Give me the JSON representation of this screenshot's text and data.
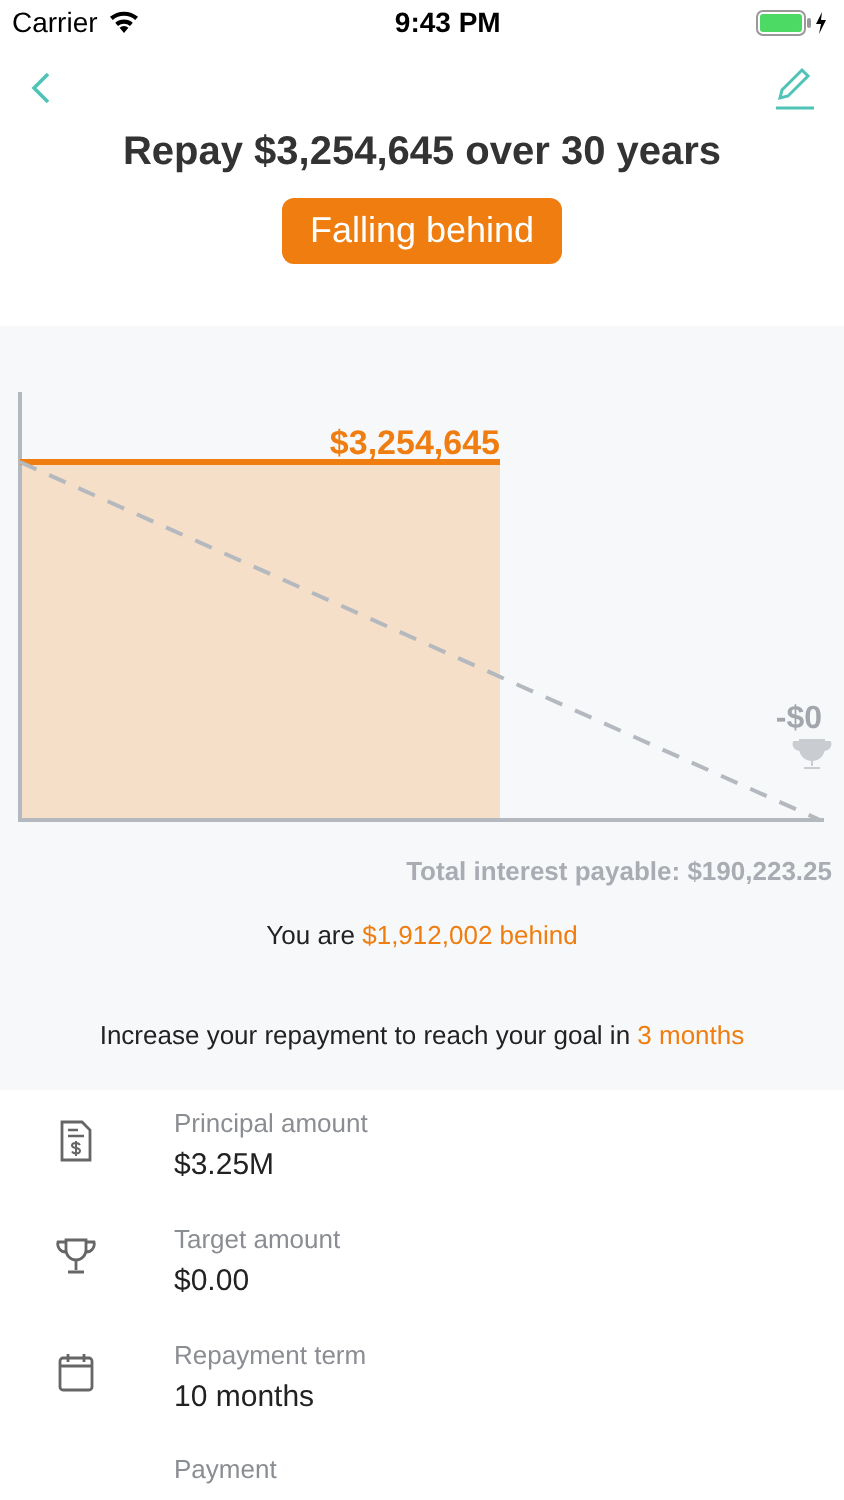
{
  "status_bar": {
    "carrier": "Carrier",
    "time": "9:43 PM"
  },
  "title": "Repay $3,254,645 over 30 years",
  "status_badge": "Falling behind",
  "chart": {
    "amount_label": "$3,254,645",
    "goal_label": "-$0"
  },
  "total_interest": "Total interest payable: $190,223.25",
  "behind": {
    "prefix": "You are ",
    "highlight": "$1,912,002 behind"
  },
  "advice": {
    "prefix": "Increase your repayment to reach your goal in ",
    "highlight": "3 months"
  },
  "details": [
    {
      "kind": "document",
      "label": "Principal amount",
      "value": "$3.25M"
    },
    {
      "kind": "trophy",
      "label": "Target amount",
      "value": "$0.00"
    },
    {
      "kind": "calendar",
      "label": "Repayment term",
      "value": "10 months"
    },
    {
      "kind": "none",
      "label": "Payment"
    }
  ]
}
